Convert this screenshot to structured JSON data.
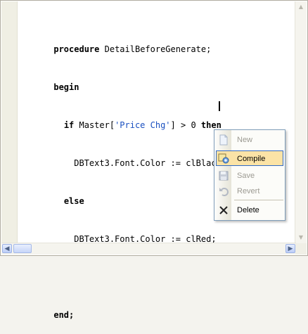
{
  "code": {
    "lines": [
      [
        {
          "t": "procedure",
          "s": "kw"
        },
        {
          "t": " DetailBeforeGenerate;",
          "s": ""
        }
      ],
      [
        {
          "t": "begin",
          "s": "kw"
        }
      ],
      [
        {
          "t": "  ",
          "s": ""
        },
        {
          "t": "if",
          "s": "kw"
        },
        {
          "t": " Master[",
          "s": ""
        },
        {
          "t": "'Price Chg'",
          "s": "str"
        },
        {
          "t": "] > 0 ",
          "s": ""
        },
        {
          "t": "then",
          "s": "kw"
        }
      ],
      [
        {
          "t": "    DBText3.Font.Color := clBlack",
          "s": ""
        }
      ],
      [
        {
          "t": "  ",
          "s": ""
        },
        {
          "t": "else",
          "s": "kw"
        }
      ],
      [
        {
          "t": "    DBText3.Font.Color := clRed;",
          "s": ""
        }
      ],
      [],
      [
        {
          "t": "end;",
          "s": "kw"
        }
      ]
    ]
  },
  "context_menu": {
    "items": [
      {
        "label": "New",
        "icon": "new-document-icon",
        "enabled": false,
        "highlighted": false
      },
      {
        "label": "Compile",
        "icon": "compile-icon",
        "enabled": true,
        "highlighted": true
      },
      {
        "label": "Save",
        "icon": "save-icon",
        "enabled": false,
        "highlighted": false
      },
      {
        "label": "Revert",
        "icon": "revert-icon",
        "enabled": false,
        "highlighted": false
      },
      {
        "label": "Delete",
        "icon": "delete-icon",
        "enabled": true,
        "highlighted": false
      }
    ]
  },
  "colors": {
    "string_literal": "#1a50c0",
    "menu_highlight": "#fbe3a6",
    "menu_highlight_border": "#316ac5"
  }
}
